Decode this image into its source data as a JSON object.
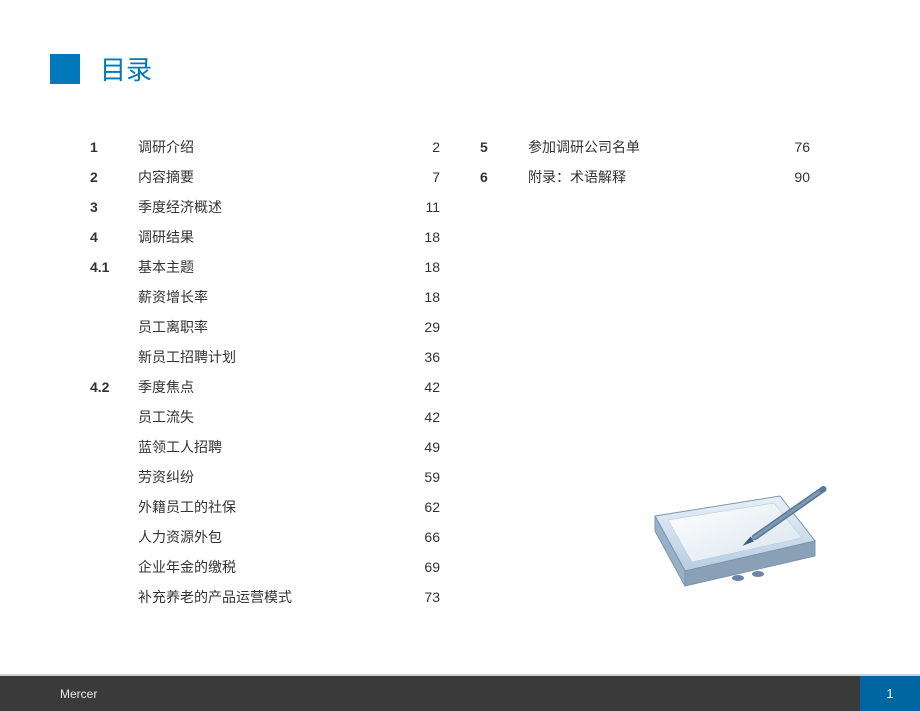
{
  "title": "目录",
  "footer": {
    "brand": "Mercer",
    "page": "1"
  },
  "toc_left": [
    {
      "num": "1",
      "label": "调研介绍",
      "page": "2",
      "indent": false
    },
    {
      "num": "2",
      "label": "内容摘要",
      "page": "7",
      "indent": false
    },
    {
      "num": "3",
      "label": "季度经济概述",
      "page": "11",
      "indent": false
    },
    {
      "num": "4",
      "label": "调研结果",
      "page": "18",
      "indent": false
    },
    {
      "num": "4.1",
      "label": "基本主题",
      "page": "18",
      "indent": false
    },
    {
      "num": "",
      "label": "薪资增长率",
      "page": "18",
      "indent": true
    },
    {
      "num": "",
      "label": "员工离职率",
      "page": "29",
      "indent": true
    },
    {
      "num": "",
      "label": "新员工招聘计划",
      "page": "36",
      "indent": true
    },
    {
      "num": "4.2",
      "label": "季度焦点",
      "page": "42",
      "indent": false
    },
    {
      "num": "",
      "label": "员工流失",
      "page": "42",
      "indent": true
    },
    {
      "num": "",
      "label": "蓝领工人招聘",
      "page": "49",
      "indent": true
    },
    {
      "num": "",
      "label": "劳资纠纷",
      "page": "59",
      "indent": true
    },
    {
      "num": "",
      "label": "外籍员工的社保",
      "page": "62",
      "indent": true
    },
    {
      "num": "",
      "label": "人力资源外包",
      "page": "66",
      "indent": true
    },
    {
      "num": "",
      "label": "企业年金的缴税",
      "page": "69",
      "indent": true
    },
    {
      "num": "",
      "label": "补充养老的产品运营模式",
      "page": "73",
      "indent": true
    }
  ],
  "toc_right": [
    {
      "num": "5",
      "label": "参加调研公司名单",
      "page": "76",
      "indent": false
    },
    {
      "num": "6",
      "label": "附录：术语解释",
      "page": "90",
      "indent": false
    }
  ]
}
